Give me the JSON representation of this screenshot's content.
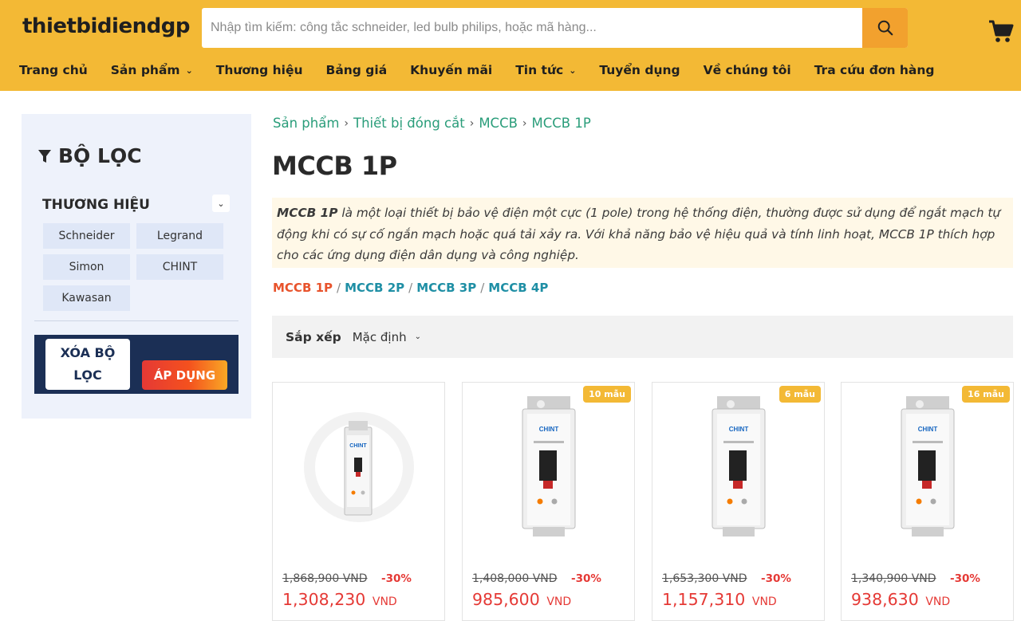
{
  "header": {
    "logo": "thietbidiendgp",
    "search_placeholder": "Nhập tìm kiếm: công tắc schneider, led bulb philips, hoặc mã hàng...",
    "search_icon": "search-icon",
    "cart_icon": "cart-icon",
    "accent_color": "#f3b935"
  },
  "nav": {
    "items": [
      {
        "label": "Trang chủ"
      },
      {
        "label": "Sản phẩm"
      },
      {
        "label": "Thương hiệu"
      },
      {
        "label": "Bảng giá"
      },
      {
        "label": "Khuyến mãi"
      },
      {
        "label": "Tin tức"
      },
      {
        "label": "Tuyển dụng"
      },
      {
        "label": "Về chúng tôi"
      },
      {
        "label": "Tra cứu đơn hàng"
      }
    ]
  },
  "sidebar": {
    "title": "BỘ LỌC",
    "brand_heading": "THƯƠNG HIỆU",
    "brands": [
      "Schneider",
      "Legrand",
      "Simon",
      "CHINT",
      "Kawasan"
    ],
    "clear_label": "XÓA BỘ LỌC",
    "apply_label": "ÁP DỤNG"
  },
  "breadcrumb": [
    "Sản phẩm",
    "Thiết bị đóng cắt",
    "MCCB",
    "MCCB 1P"
  ],
  "page_title": "MCCB 1P",
  "description": {
    "bold": "MCCB 1P",
    "text": " là một loại thiết bị bảo vệ điện một cực (1 pole) trong hệ thống điện, thường được sử dụng để ngắt mạch tự động khi có sự cố ngắn mạch hoặc quá tải xảy ra. Với khả năng bảo vệ hiệu quả và tính linh hoạt, MCCB 1P thích hợp cho các ứng dụng điện dân dụng và công nghiệp."
  },
  "variants": [
    "MCCB 1P",
    "MCCB 2P",
    "MCCB 3P",
    "MCCB 4P"
  ],
  "sort": {
    "label": "Sắp xếp",
    "value": "Mặc định"
  },
  "products": [
    {
      "badge": "",
      "old_price": "1,868,900 VND",
      "discount": "-30%",
      "price": "1,308,230",
      "currency": "VND"
    },
    {
      "badge": "10 mẫu",
      "old_price": "1,408,000 VND",
      "discount": "-30%",
      "price": "985,600",
      "currency": "VND"
    },
    {
      "badge": "6 mẫu",
      "old_price": "1,653,300 VND",
      "discount": "-30%",
      "price": "1,157,310",
      "currency": "VND"
    },
    {
      "badge": "16 mẫu",
      "old_price": "1,340,900 VND",
      "discount": "-30%",
      "price": "938,630",
      "currency": "VND"
    }
  ],
  "product_image_brand": "CHINT",
  "colors": {
    "link": "#2a9d7a",
    "variant_active": "#e8532c",
    "variant": "#1f8fa5",
    "price": "#e53935",
    "sidebar_bg": "#eef2fb",
    "action_bar": "#1b2f55"
  }
}
